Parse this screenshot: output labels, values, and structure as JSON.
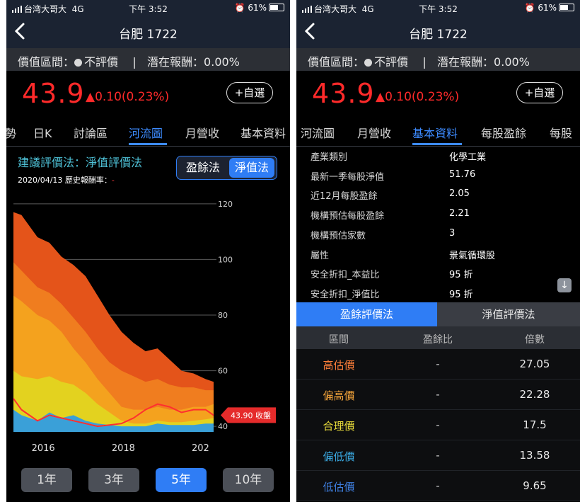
{
  "status": {
    "carrier": "台湾大哥大",
    "network": "4G",
    "time": "下午 3:52",
    "battery": "61%"
  },
  "nav": {
    "title": "台肥 1722",
    "back_icon": "chevron-left-icon"
  },
  "valuation": {
    "range_label": "價值區間：",
    "range_value": "不評價",
    "sep": "|",
    "return_label": "潛在報酬：",
    "return_value": "0.00%"
  },
  "quote": {
    "price": "43.9",
    "change": "▲0.10(0.23%)",
    "add_watch": "+自選"
  },
  "left_tabs": [
    "勢",
    "日K",
    "討論區",
    "河流圖",
    "月營收",
    "基本資料"
  ],
  "right_tabs": [
    "河流圖",
    "月營收",
    "基本資料",
    "每股盈餘",
    "每股"
  ],
  "river": {
    "suggest": "建議評價法：淨值評價法",
    "history_prefix": "2020/04/13 歷史報酬率：",
    "history_value": "-",
    "method_a": "盈餘法",
    "method_b": "淨值法",
    "close_tag": "43.90 收盤"
  },
  "range_buttons": [
    "1年",
    "3年",
    "5年",
    "10年"
  ],
  "range_selected": "5年",
  "chart_data": {
    "type": "area",
    "y_ticks": [
      "120",
      "100",
      "80",
      "60",
      "40"
    ],
    "x_ticks": [
      "2016",
      "2018",
      "202"
    ],
    "ylim": [
      38,
      122
    ],
    "x": [
      2015.3,
      2015.5,
      2015.9,
      2016.2,
      2016.5,
      2016.8,
      2017.1,
      2017.4,
      2017.7,
      2018.0,
      2018.3,
      2018.6,
      2018.9,
      2019.2,
      2019.5,
      2019.8,
      2020.1,
      2020.3
    ],
    "xlim": [
      2015.3,
      2020.3
    ],
    "series": [
      {
        "color": "#3aa0d8",
        "values": [
          46,
          44,
          42,
          45,
          43,
          44,
          42,
          41,
          40.5,
          40,
          40,
          40,
          41,
          40.5,
          40.5,
          40.5,
          41,
          41
        ]
      },
      {
        "color": "#e3d21f",
        "values": [
          60,
          58,
          57,
          58,
          56,
          55,
          52,
          48,
          45,
          42,
          41,
          41,
          42,
          41.5,
          41.5,
          42,
          42.5,
          43
        ]
      },
      {
        "color": "#f4a21e",
        "values": [
          87,
          85,
          80,
          78,
          74,
          68,
          63,
          57,
          52,
          47,
          46,
          46,
          47,
          46,
          46,
          47,
          47,
          48
        ]
      },
      {
        "color": "#f07d1f",
        "values": [
          99,
          96,
          90,
          88,
          84,
          79,
          74,
          68,
          63,
          60,
          58,
          56,
          57,
          55,
          54,
          54,
          53,
          53
        ]
      },
      {
        "color": "#e4541a",
        "values": [
          117,
          116,
          108,
          106,
          101,
          98,
          94,
          87,
          80,
          74,
          70,
          67,
          68,
          64,
          60,
          59,
          57,
          56
        ]
      }
    ],
    "price": {
      "color": "#ff2f2f",
      "values": [
        50,
        46,
        42,
        44,
        43,
        42,
        41,
        40,
        40.5,
        41,
        43,
        46,
        48,
        47,
        45,
        46,
        46,
        44
      ]
    }
  },
  "basic_info": [
    {
      "key": "產業類別",
      "value": "化學工業"
    },
    {
      "key": "最新一季每股淨值",
      "value": "51.76"
    },
    {
      "key": "近12月每股盈餘",
      "value": "2.05"
    },
    {
      "key": "機構預估每股盈餘",
      "value": "2.21"
    },
    {
      "key": "機構預估家數",
      "value": "3"
    },
    {
      "key": "屬性",
      "value": "景氣循環股"
    },
    {
      "key": "安全折扣_本益比",
      "value": "95 折"
    },
    {
      "key": "安全折扣_淨值比",
      "value": "95 折"
    }
  ],
  "download_icon": "arrow-down-icon",
  "method_tabs": [
    "盈餘評價法",
    "淨值評價法"
  ],
  "valuation_table": {
    "headers": [
      "區間",
      "盈餘比",
      "倍數"
    ],
    "rows": [
      {
        "label": "高估價",
        "ratio": "-",
        "value": "27.05",
        "color": "#ff7f3a"
      },
      {
        "label": "偏高價",
        "ratio": "-",
        "value": "22.28",
        "color": "#f2a33a"
      },
      {
        "label": "合理價",
        "ratio": "-",
        "value": "17.5",
        "color": "#e9dc3b"
      },
      {
        "label": "偏低價",
        "ratio": "-",
        "value": "13.58",
        "color": "#3aa8e0"
      },
      {
        "label": "低估價",
        "ratio": "-",
        "value": "9.65",
        "color": "#3f7fe0"
      }
    ]
  }
}
